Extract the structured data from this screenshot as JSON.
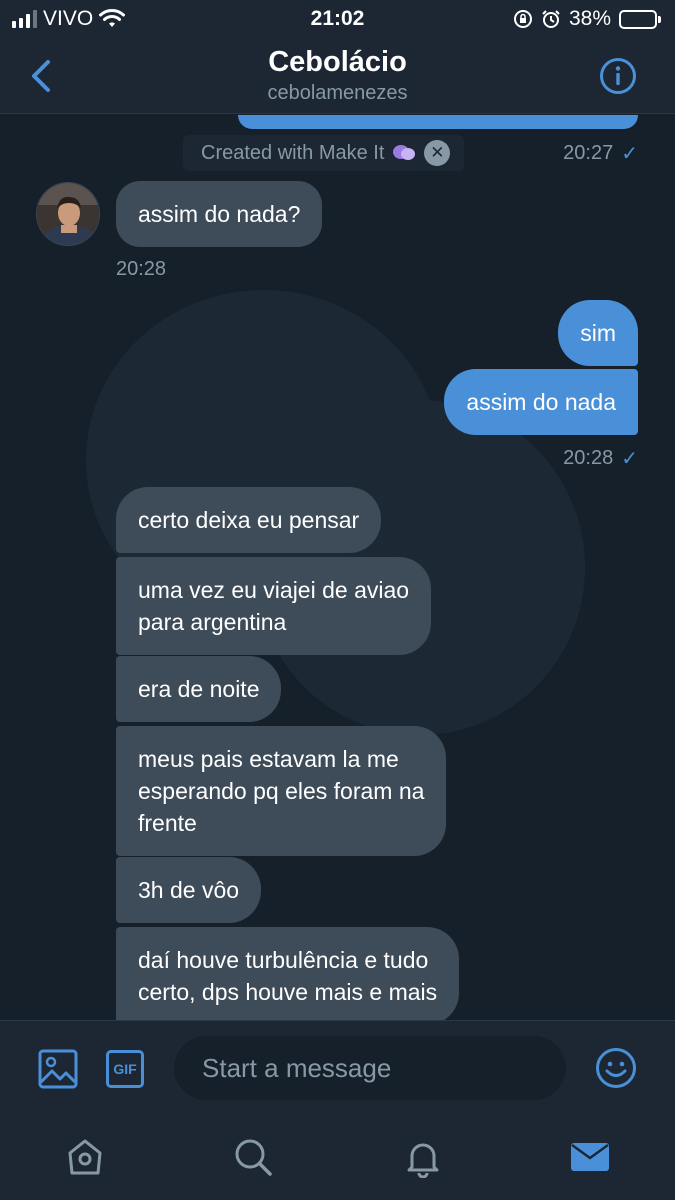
{
  "status_bar": {
    "carrier": "VIVO",
    "time": "21:02",
    "battery": "38%",
    "battery_level": 0.38
  },
  "header": {
    "title": "Cebolácio",
    "subtitle": "cebolamenezes"
  },
  "watermark": {
    "text": "Created with Make It"
  },
  "messages": [
    {
      "dir": "out",
      "time": "20:27",
      "read": true
    },
    {
      "dir": "in",
      "text": "assim do nada?",
      "time": "20:28"
    },
    {
      "dir": "out",
      "text": "sim"
    },
    {
      "dir": "out",
      "text": "assim do nada",
      "time": "20:28",
      "read": true
    },
    {
      "dir": "in",
      "text": "certo deixa eu pensar"
    },
    {
      "dir": "in",
      "text": "uma vez eu viajei de aviao\npara argentina"
    },
    {
      "dir": "in",
      "text": "era de noite"
    },
    {
      "dir": "in",
      "text": "meus pais estavam la me\nesperando pq eles foram na\nfrente"
    },
    {
      "dir": "in",
      "text": "3h de vôo"
    },
    {
      "dir": "in",
      "text": "daí houve turbulência e tudo\ncerto, dps houve mais e mais"
    }
  ],
  "composer": {
    "placeholder": "Start a message",
    "gif_label": "GIF"
  },
  "colors": {
    "background": "#15202b",
    "bar": "#1c2733",
    "accent": "#4a90d9",
    "incoming_bubble": "#3e4b59",
    "muted_text": "#8899a6"
  },
  "icons": {
    "back": "chevron-left-icon",
    "info": "info-icon",
    "image": "image-icon",
    "gif": "gif-icon",
    "emoji": "emoji-icon",
    "home": "home-icon",
    "search": "search-icon",
    "notifications": "bell-icon",
    "messages": "mail-icon"
  }
}
